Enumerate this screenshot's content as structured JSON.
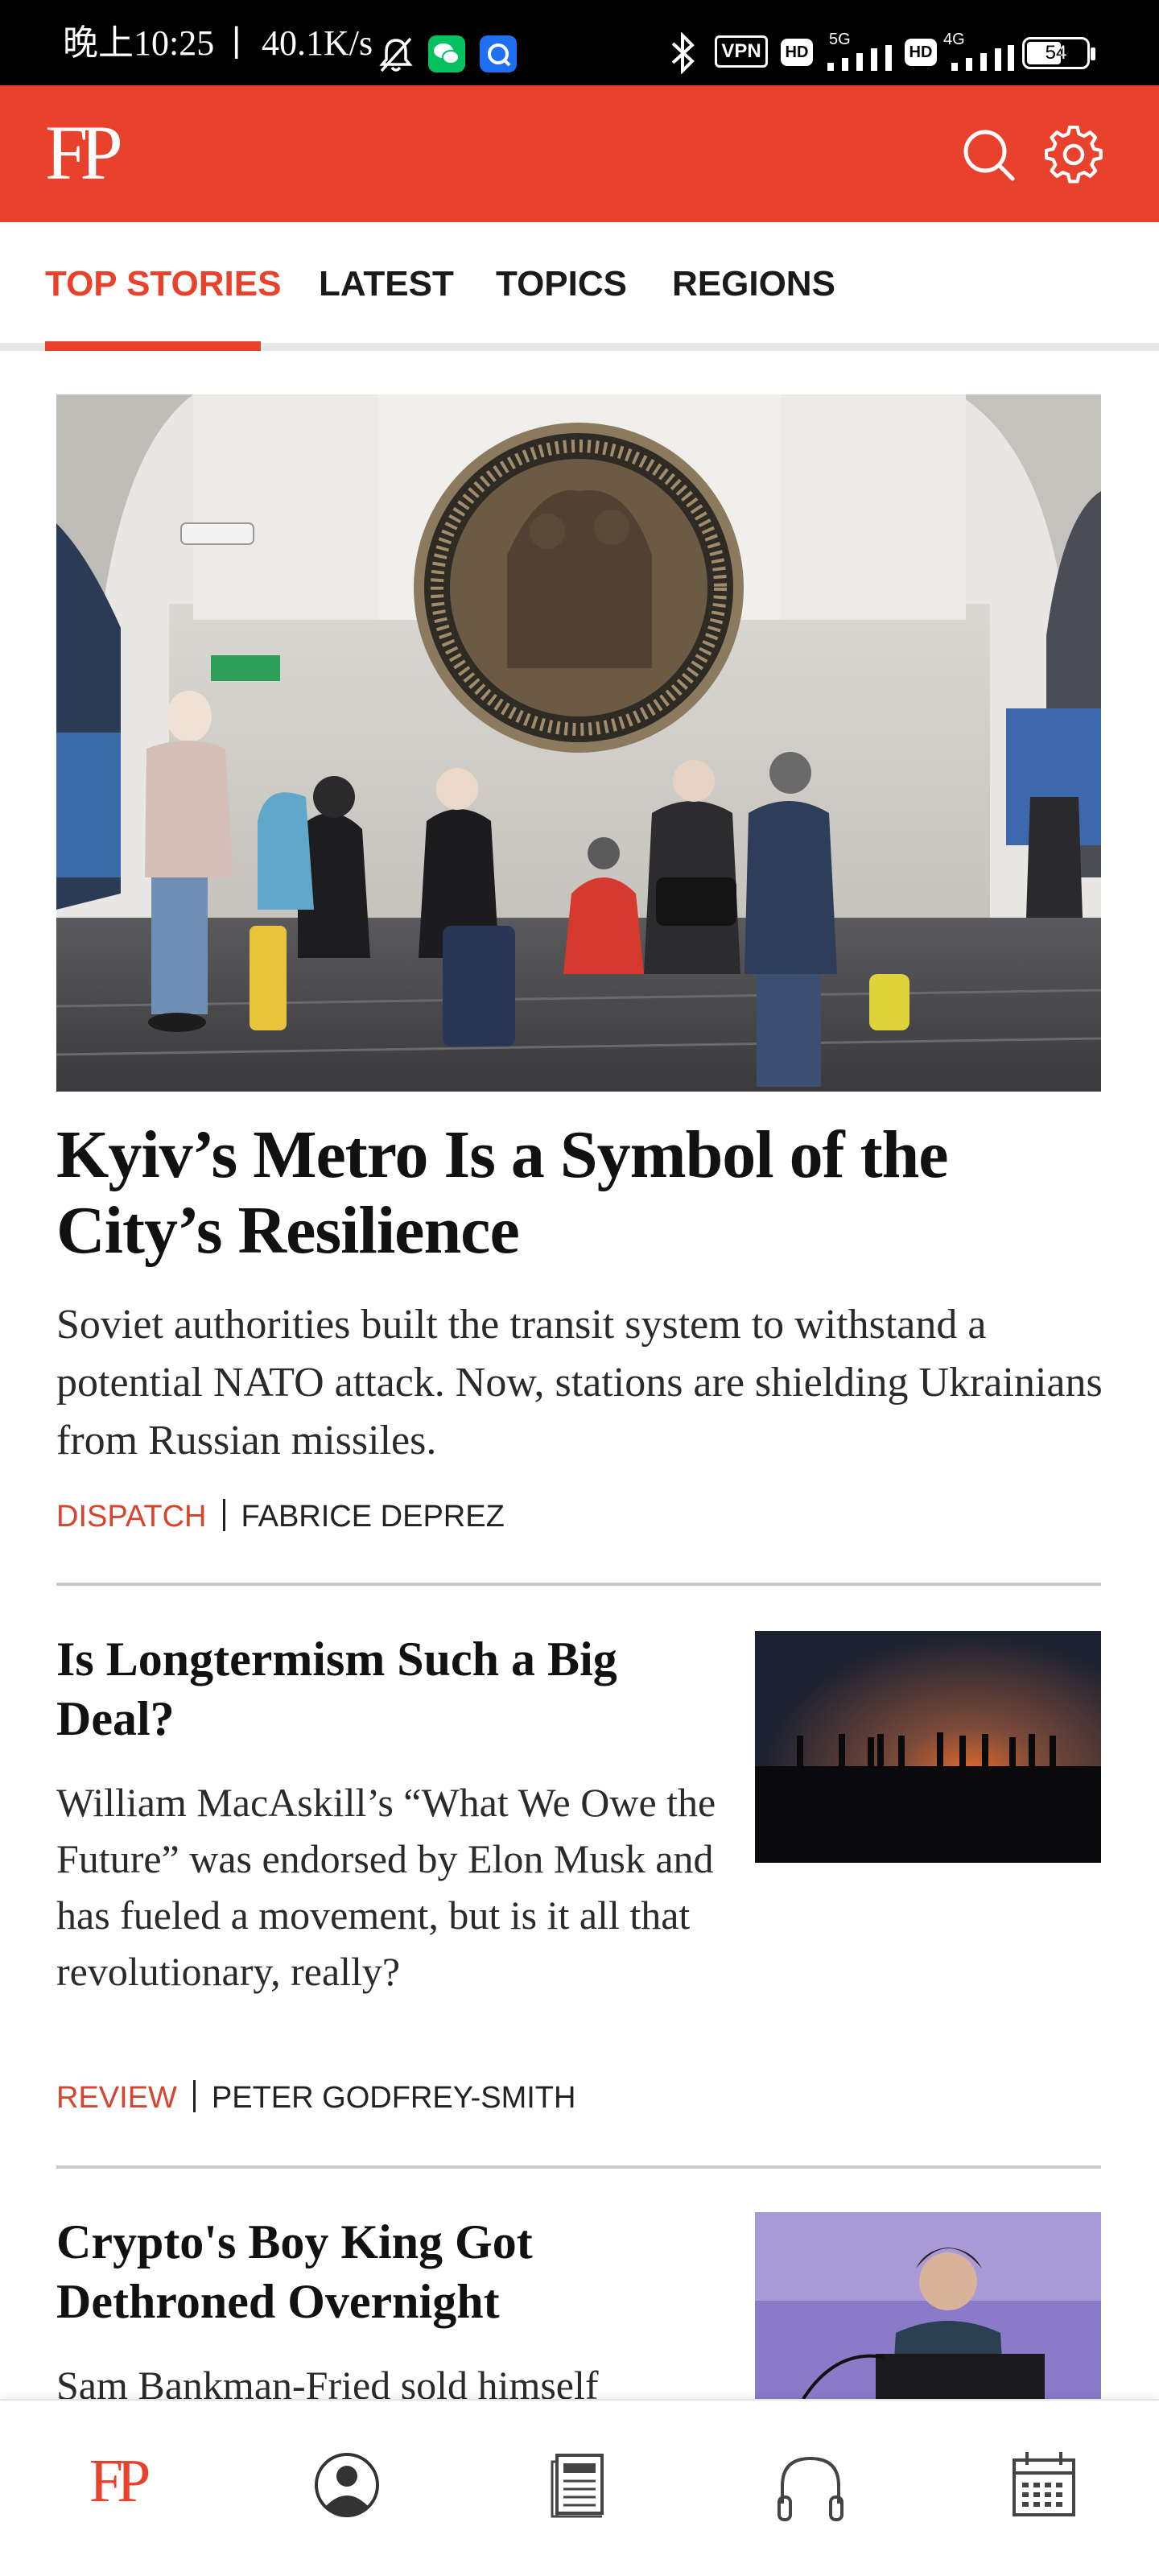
{
  "status_bar": {
    "time": "晚上10:25",
    "separator": "|",
    "net_speed": "40.1K/s",
    "vpn": "VPN",
    "hd1": "HD",
    "net1": "5G",
    "hd2": "HD",
    "net2": "4G",
    "battery": "54"
  },
  "app_bar": {
    "logo": "FP",
    "brand_color": "#e8412c"
  },
  "tabs": [
    {
      "label": "TOP STORIES",
      "active": true
    },
    {
      "label": "LATEST",
      "active": false
    },
    {
      "label": "TOPICS",
      "active": false
    },
    {
      "label": "REGIONS",
      "active": false
    }
  ],
  "hero": {
    "title": "Kyiv’s Metro Is a Symbol of the City’s Resilience",
    "dek": "Soviet authorities built the transit system to withstand a potential NATO attack. Now, stations are shielding Ukrainians from Russian missiles.",
    "kicker": "DISPATCH",
    "author": "FABRICE DEPREZ"
  },
  "articles": [
    {
      "title": "Is Longtermism Such a Big Deal?",
      "dek": "William MacAskill’s “What We Owe the Future” was endorsed by Elon Musk and has fueled a movement, but is it all that revolutionary, really?",
      "kicker": "REVIEW",
      "author": "PETER GODFREY-SMITH"
    },
    {
      "title": "Crypto's Boy King Got Dethroned Overnight",
      "dek": "Sam Bankman-Fried sold himself"
    }
  ],
  "bottom_nav": {
    "home_logo": "FP",
    "items": [
      "home-logo",
      "profile-icon",
      "newspaper-icon",
      "headphones-icon",
      "calendar-icon"
    ]
  }
}
